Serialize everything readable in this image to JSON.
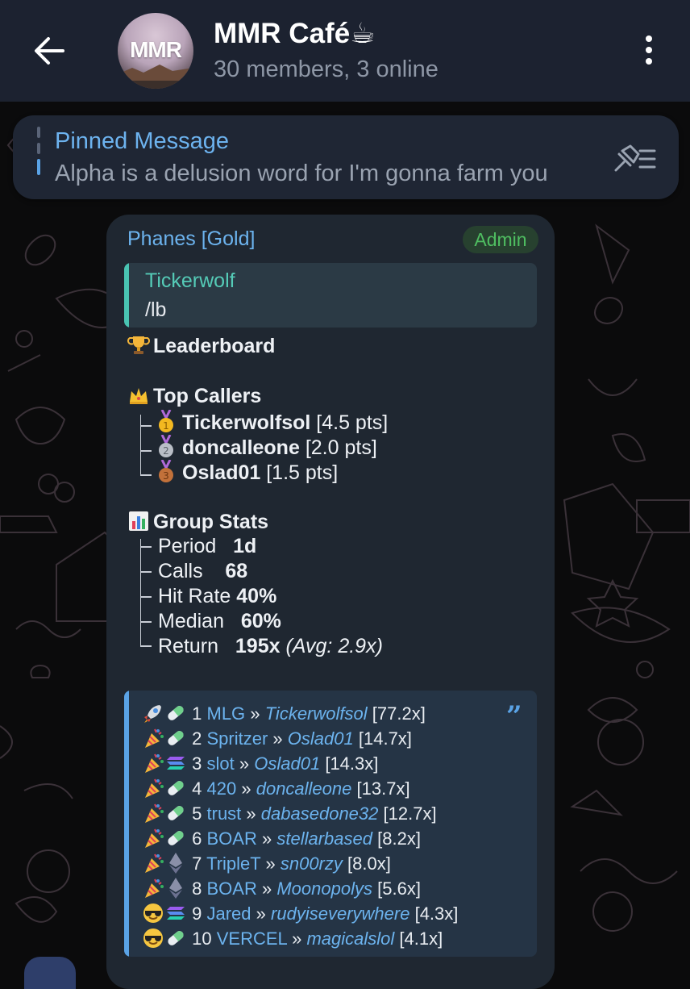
{
  "header": {
    "title": "MMR Café",
    "title_emoji": "☕",
    "subtitle": "30 members, 3 online",
    "avatar_text": "MMR"
  },
  "pinned": {
    "title": "Pinned Message",
    "text": "Alpha is a delusion word for I'm gonna farm you"
  },
  "message": {
    "sender": "Phanes [Gold]",
    "badge": "Admin",
    "reply": {
      "name": "Tickerwolf",
      "text": "/lb"
    },
    "leaderboard_title": "Leaderboard",
    "top_callers_title": "Top Callers",
    "callers": [
      {
        "name": "Tickerwolfsol",
        "pts": "[4.5 pts]",
        "medal": "gold-medal"
      },
      {
        "name": "doncalleone",
        "pts": "[2.0 pts]",
        "medal": "silver-medal"
      },
      {
        "name": "Oslad01",
        "pts": "[1.5 pts]",
        "medal": "bronze-medal"
      }
    ],
    "group_stats_title": "Group Stats",
    "stats": [
      {
        "label": "Period",
        "value": "1d",
        "extra": ""
      },
      {
        "label": "Calls",
        "value": "68",
        "extra": ""
      },
      {
        "label": "Hit Rate",
        "value": "40%",
        "extra": ""
      },
      {
        "label": "Median",
        "value": "60%",
        "extra": ""
      },
      {
        "label": "Return",
        "value": "195x",
        "extra": "(Avg: 2.9x)"
      }
    ],
    "calls": [
      {
        "rank": "1",
        "token": "MLG",
        "user": "Tickerwolfsol",
        "mult": "[77.2x]",
        "lead": "rocket",
        "chain": "pill"
      },
      {
        "rank": "2",
        "token": "Spritzer",
        "user": "Oslad01",
        "mult": "[14.7x]",
        "lead": "party",
        "chain": "pill"
      },
      {
        "rank": "3",
        "token": "slot",
        "user": "Oslad01",
        "mult": "[14.3x]",
        "lead": "party",
        "chain": "solana"
      },
      {
        "rank": "4",
        "token": "420",
        "user": "doncalleone",
        "mult": "[13.7x]",
        "lead": "party",
        "chain": "pill"
      },
      {
        "rank": "5",
        "token": "trust",
        "user": "dabasedone32",
        "mult": "[12.7x]",
        "lead": "party",
        "chain": "pill"
      },
      {
        "rank": "6",
        "token": "BOAR",
        "user": "stellarbased",
        "mult": "[8.2x]",
        "lead": "party",
        "chain": "pill"
      },
      {
        "rank": "7",
        "token": "TripleT",
        "user": "sn00rzy",
        "mult": "[8.0x]",
        "lead": "party",
        "chain": "ethereum"
      },
      {
        "rank": "8",
        "token": "BOAR",
        "user": "Moonopolys",
        "mult": "[5.6x]",
        "lead": "party",
        "chain": "ethereum"
      },
      {
        "rank": "9",
        "token": "Jared",
        "user": "rudyiseverywhere",
        "mult": "[4.3x]",
        "lead": "sunglasses",
        "chain": "solana"
      },
      {
        "rank": "10",
        "token": "VERCEL",
        "user": "magicalslol",
        "mult": "[4.1x]",
        "lead": "sunglasses",
        "chain": "pill"
      }
    ],
    "separator": "»"
  },
  "colors": {
    "header_bg": "#1c2230",
    "bubble_bg": "#1f2731",
    "link": "#6cb3ee",
    "admin_badge": "#4fbe61",
    "reply_accent": "#49c4b2"
  }
}
